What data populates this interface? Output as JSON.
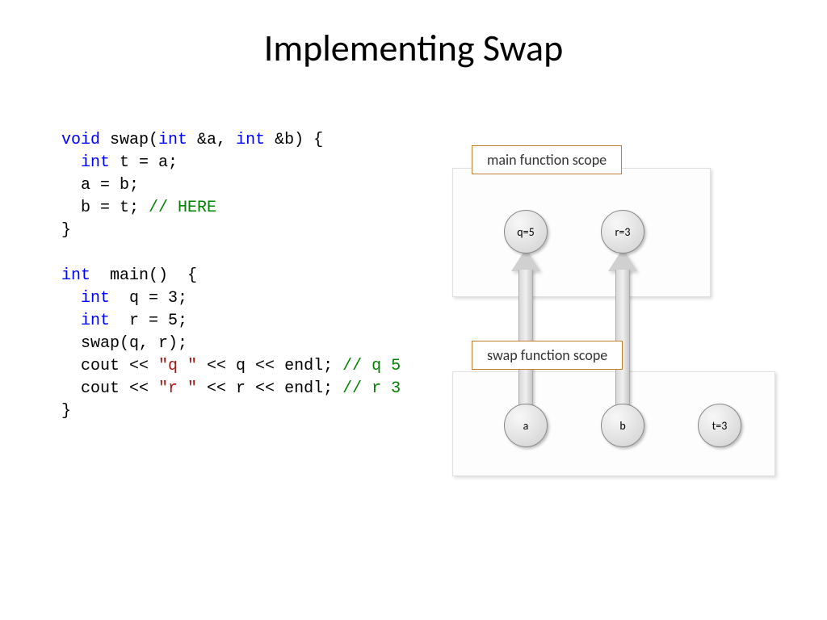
{
  "title": "Implementing Swap",
  "code": {
    "l1_void": "void",
    "l1_rest": " swap(",
    "l1_int1": "int",
    "l1_mid": " &a, ",
    "l1_int2": "int",
    "l1_end": " &b) {",
    "l2_int": "int",
    "l2_rest": " t = a;",
    "l3": "  a = b;",
    "l4_a": "  b = t; ",
    "l4_cm": "// HERE",
    "l5": "}",
    "l6_int": "int",
    "l6_rest": "  main()  {",
    "l7_int": "int",
    "l7_rest": "  q = 3;",
    "l8_int": "int",
    "l8_rest": "  r = 5;",
    "l9": "  swap(q, r);",
    "l10_a": "  cout << ",
    "l10_s": "\"q \"",
    "l10_b": " << q << endl; ",
    "l10_cm": "// q 5",
    "l11_a": "  cout << ",
    "l11_s": "\"r \"",
    "l11_b": " << r << endl; ",
    "l11_cm": "// r 3",
    "l12": "}"
  },
  "diagram": {
    "main_scope_label": "main function scope",
    "swap_scope_label": "swap function scope",
    "node_q": "q=5",
    "node_r": "r=3",
    "node_a": "a",
    "node_b": "b",
    "node_t": "t=3"
  }
}
